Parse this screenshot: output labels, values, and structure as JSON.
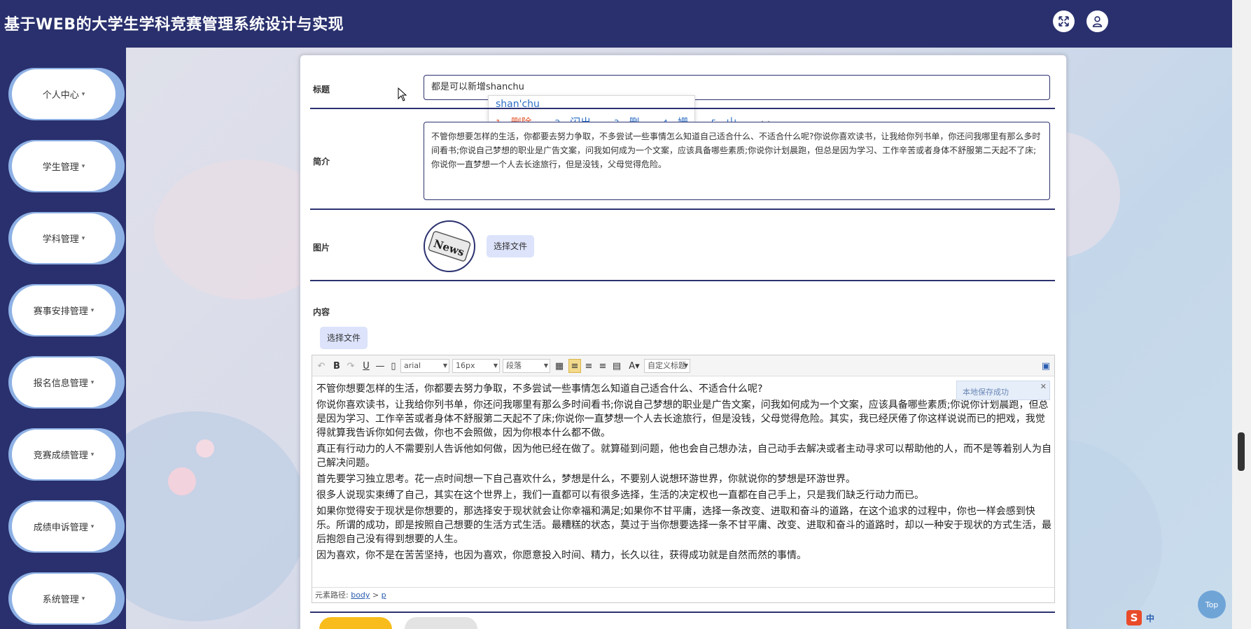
{
  "header": {
    "app_title": "基于WEB的大学生学科竞赛管理系统设计与实现"
  },
  "sidebar": {
    "items": [
      {
        "label": "个人中心"
      },
      {
        "label": "学生管理"
      },
      {
        "label": "学科管理"
      },
      {
        "label": "赛事安排管理"
      },
      {
        "label": "报名信息管理"
      },
      {
        "label": "竞赛成绩管理"
      },
      {
        "label": "成绩申诉管理"
      },
      {
        "label": "系统管理"
      }
    ],
    "caret": "▾"
  },
  "form": {
    "title_label": "标题",
    "title_value": "都是可以新增shanchu",
    "intro_label": "简介",
    "intro_value": "不管你想要怎样的生活，你都要去努力争取，不多尝试一些事情怎么知道自己适合什么、不适合什么呢?你说你喜欢读书，让我给你列书单，你还问我哪里有那么多时间看书;你说自己梦想的职业是广告文案，问我如何成为一个文案，应该具备哪些素质;你说你计划晨跑，但总是因为学习、工作辛苦或者身体不舒服第二天起不了床;你说你一直梦想一个人去长途旅行，但是没钱，父母觉得危险。",
    "image_label": "图片",
    "image_file_button": "选择文件",
    "content_label": "内容",
    "content_file_button": "选择文件",
    "news_graphic_text": "News"
  },
  "ime": {
    "pinyin": "shan'chu",
    "candidates": [
      {
        "index": "1",
        "text": "删除"
      },
      {
        "index": "2",
        "text": "闪出"
      },
      {
        "index": "3",
        "text": "删"
      },
      {
        "index": "4",
        "text": "姗"
      },
      {
        "index": "5",
        "text": "山"
      }
    ],
    "nav": "‹ ›"
  },
  "editor": {
    "toolbar": {
      "font_family": "arial",
      "font_size": "16px",
      "paragraph": "段落",
      "custom_heading": "自定义标题"
    },
    "paragraphs": [
      "不管你想要怎样的生活，你都要去努力争取，不多尝试一些事情怎么知道自己适合什么、不适合什么呢?",
      "你说你喜欢读书，让我给你列书单，你还问我哪里有那么多时间看书;你说自己梦想的职业是广告文案，问我如何成为一个文案，应该具备哪些素质;你说你计划晨跑，但总是因为学习、工作辛苦或者身体不舒服第二天起不了床;你说你一直梦想一个人去长途旅行，但是没钱，父母觉得危险。其实，我已经厌倦了你这样说说而已的把戏，我觉得就算我告诉你如何去做，你也不会照做，因为你根本什么都不做。",
      "真正有行动力的人不需要别人告诉他如何做，因为他已经在做了。就算碰到问题，他也会自己想办法，自己动手去解决或者主动寻求可以帮助他的人，而不是等着别人为自己解决问题。",
      "首先要学习独立思考。花一点时间想一下自己喜欢什么，梦想是什么，不要别人说想环游世界，你就说你的梦想是环游世界。",
      "很多人说现实束缚了自己，其实在这个世界上，我们一直都可以有很多选择，生活的决定权也一直都在自己手上，只是我们缺乏行动力而已。",
      "如果你觉得安于现状是你想要的，那选择安于现状就会让你幸福和满足;如果你不甘平庸，选择一条改变、进取和奋斗的道路，在这个追求的过程中，你也一样会感到快乐。所谓的成功，即是按照自己想要的生活方式生活。最糟糕的状态，莫过于当你想要选择一条不甘平庸、改变、进取和奋斗的道路时，却以一种安于现状的方式生活，最后抱怨自己没有得到想要的人生。",
      "因为喜欢，你不是在苦苦坚持，也因为喜欢，你愿意投入时间、精力，长久以往，获得成功就是自然而然的事情。"
    ],
    "status_prefix": "元素路径:",
    "status_body": "body",
    "status_sep": ">",
    "status_p": "p",
    "toast_text": "本地保存成功",
    "toast_close": "✕"
  },
  "misc": {
    "top_button": "Top",
    "tray_ime": "中",
    "tray_logo": "S"
  }
}
